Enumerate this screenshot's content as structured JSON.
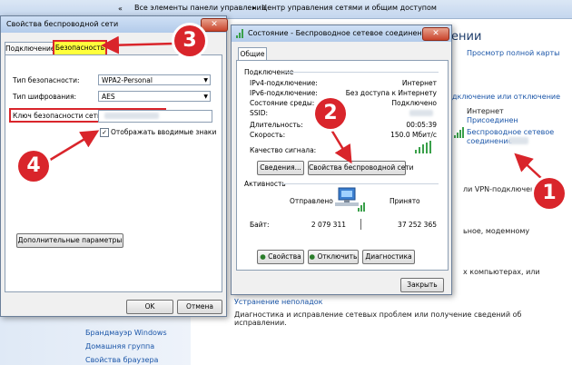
{
  "background": {
    "breadcrumb_1": "Все элементы панели управления",
    "breadcrumb_2": "Центр управления сетями и общим доступом",
    "heading_partial": "ении",
    "link_full_map": "Просмотр полной карты",
    "link_connect_disconnect": "дключение или отключение",
    "internet_label": "Интернет",
    "homegroup_link": "Присоединен",
    "wireless_link_1": "Беспроводное сетевое",
    "wireless_link_2": "соединение",
    "text_vpn": "ли VPN-подключение",
    "text_modem": "ьное, модемному",
    "text_computers": "х компьютерах, или",
    "troubleshoot_link": "Устранение неполадок",
    "troubleshoot_desc": "Диагностика и исправление сетевых проблем или получение сведений об исправлении.",
    "sidebar_items": [
      "Брандмауэр Windows",
      "Домашняя группа",
      "Свойства браузера"
    ]
  },
  "left_dialog": {
    "title": "Свойства беспроводной сети",
    "tabs": [
      "Подключение",
      "Безопасность"
    ],
    "security_type_label": "Тип безопасности:",
    "security_type_value": "WPA2-Personal",
    "encryption_label": "Тип шифрования:",
    "encryption_value": "AES",
    "key_label": "Ключ безопасности сети",
    "show_chars_label": "Отображать вводимые знаки",
    "advanced_button": "Дополнительные параметры",
    "ok_button": "OK",
    "cancel_button": "Отмена"
  },
  "right_dialog": {
    "title": "Состояние - Беспроводное сетевое соединение",
    "tab": "Общие",
    "connection_group": "Подключение",
    "rows": [
      {
        "label": "IPv4-подключение:",
        "value": "Интернет"
      },
      {
        "label": "IPv6-подключение:",
        "value": "Без доступа к Интернету"
      },
      {
        "label": "Состояние среды:",
        "value": "Подключено"
      },
      {
        "label": "SSID:",
        "value": ""
      },
      {
        "label": "Длительность:",
        "value": "00:05:39"
      },
      {
        "label": "Скорость:",
        "value": "150.0 Мбит/с"
      }
    ],
    "signal_label": "Качество сигнала:",
    "details_button": "Сведения...",
    "wireless_props_button": "Свойства беспроводной сети",
    "activity_group": "Активность",
    "sent_label": "Отправлено",
    "received_label": "Принято",
    "bytes_label": "Байт:",
    "bytes_sent": "2 079 311",
    "bytes_received": "37 252 365",
    "properties_button": "Свойства",
    "disable_button": "Отключить",
    "diagnose_button": "Диагностика",
    "close_button": "Закрыть"
  },
  "annotations": [
    "1",
    "2",
    "3",
    "4"
  ],
  "colors": {
    "annotation_red": "#d9252b",
    "link_blue": "#1a55a8",
    "highlight_yellow": "#ffff3c"
  }
}
